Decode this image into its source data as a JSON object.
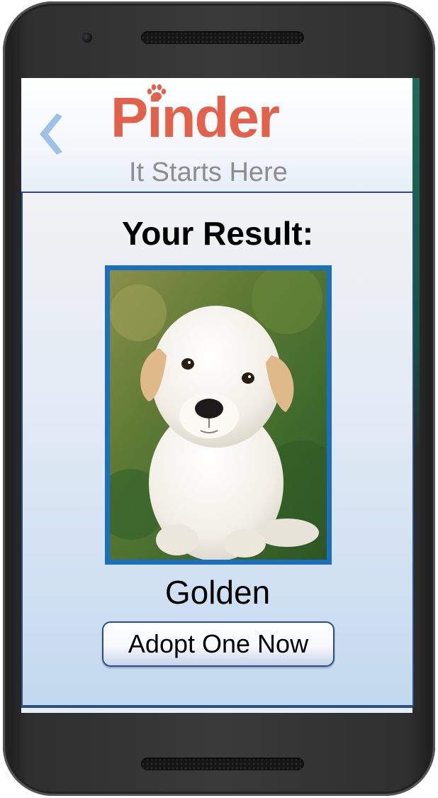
{
  "header": {
    "back_icon": "chevron-left-icon",
    "logo_text": "Pinder",
    "logo_icon": "paw-icon",
    "tagline": "It Starts Here"
  },
  "result": {
    "title": "Your Result:",
    "photo_alt": "puppy photo",
    "breed": "Golden",
    "adopt_button_label": "Adopt One Now"
  },
  "colors": {
    "brand": "#e2614a",
    "accent_blue": "#1c6fbd",
    "border": "#2c4d88",
    "back_chevron": "#9ec1e6"
  }
}
